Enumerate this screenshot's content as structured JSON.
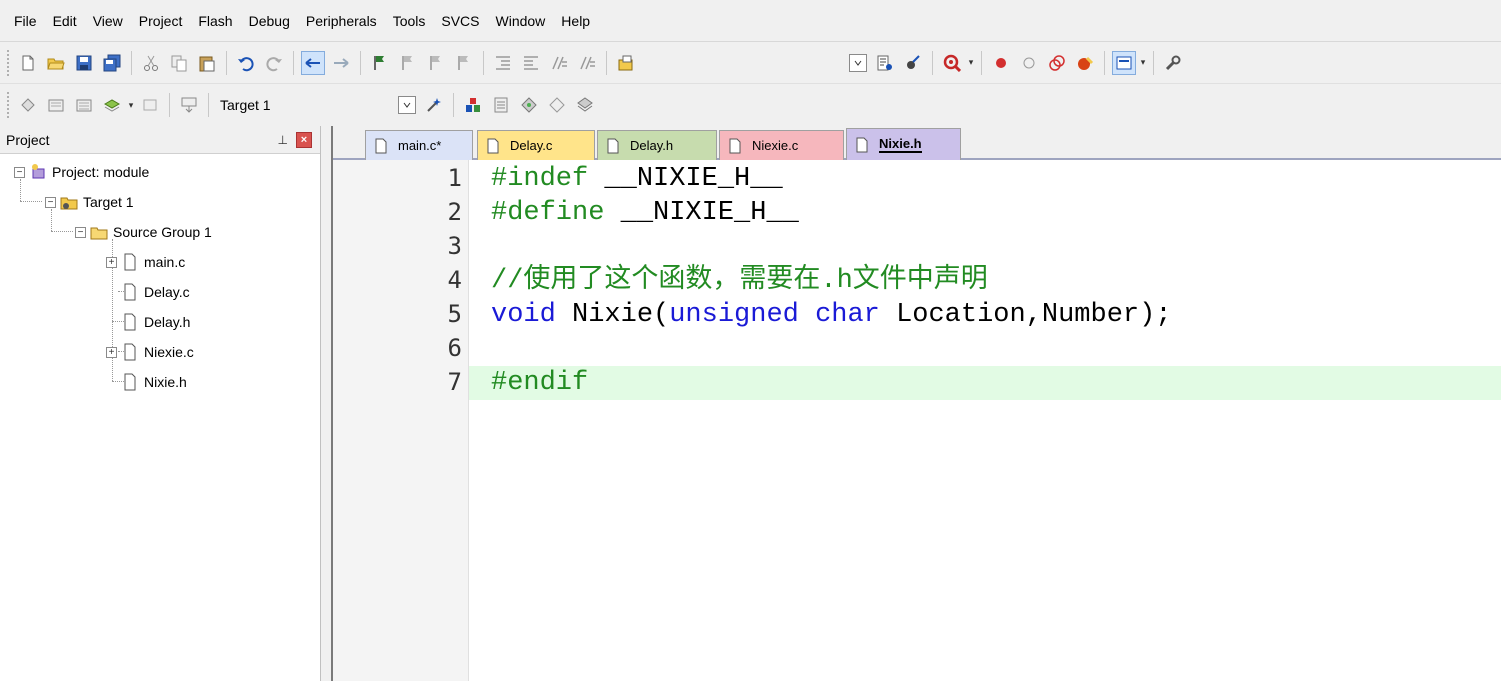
{
  "menubar": {
    "items": [
      "File",
      "Edit",
      "View",
      "Project",
      "Flash",
      "Debug",
      "Peripherals",
      "Tools",
      "SVCS",
      "Window",
      "Help"
    ]
  },
  "toolbar2": {
    "target": "Target 1"
  },
  "project_panel": {
    "title": "Project",
    "pin": "p",
    "close": "×",
    "tree": {
      "project": "Project: module",
      "target": "Target 1",
      "group": "Source Group 1",
      "files": [
        "main.c",
        "Delay.c",
        "Delay.h",
        "Niexie.c",
        "Nixie.h"
      ]
    }
  },
  "tabs": [
    {
      "label": "main.c*",
      "color": "#dbe3f7"
    },
    {
      "label": "Delay.c",
      "color": "#ffe48a"
    },
    {
      "label": "Delay.h",
      "color": "#c7dcae"
    },
    {
      "label": "Niexie.c",
      "color": "#f6b7bd"
    },
    {
      "label": "Nixie.h",
      "color": "#cbc1ea"
    }
  ],
  "editor": {
    "line_numbers": [
      "1",
      "2",
      "3",
      "4",
      "5",
      "6",
      "7"
    ],
    "lines": {
      "l1a": "#indef",
      "l1b": " __NIXIE_H__",
      "l2a": "#define",
      "l2b": " __NIXIE_H__",
      "l4": "//使用了这个函数，需要在.h文件中声明",
      "l5a": "void",
      "l5b": " Nixie(",
      "l5c": "unsigned",
      "l5d": " ",
      "l5e": "char",
      "l5f": " Location,Number);",
      "l7": "#endif"
    }
  }
}
